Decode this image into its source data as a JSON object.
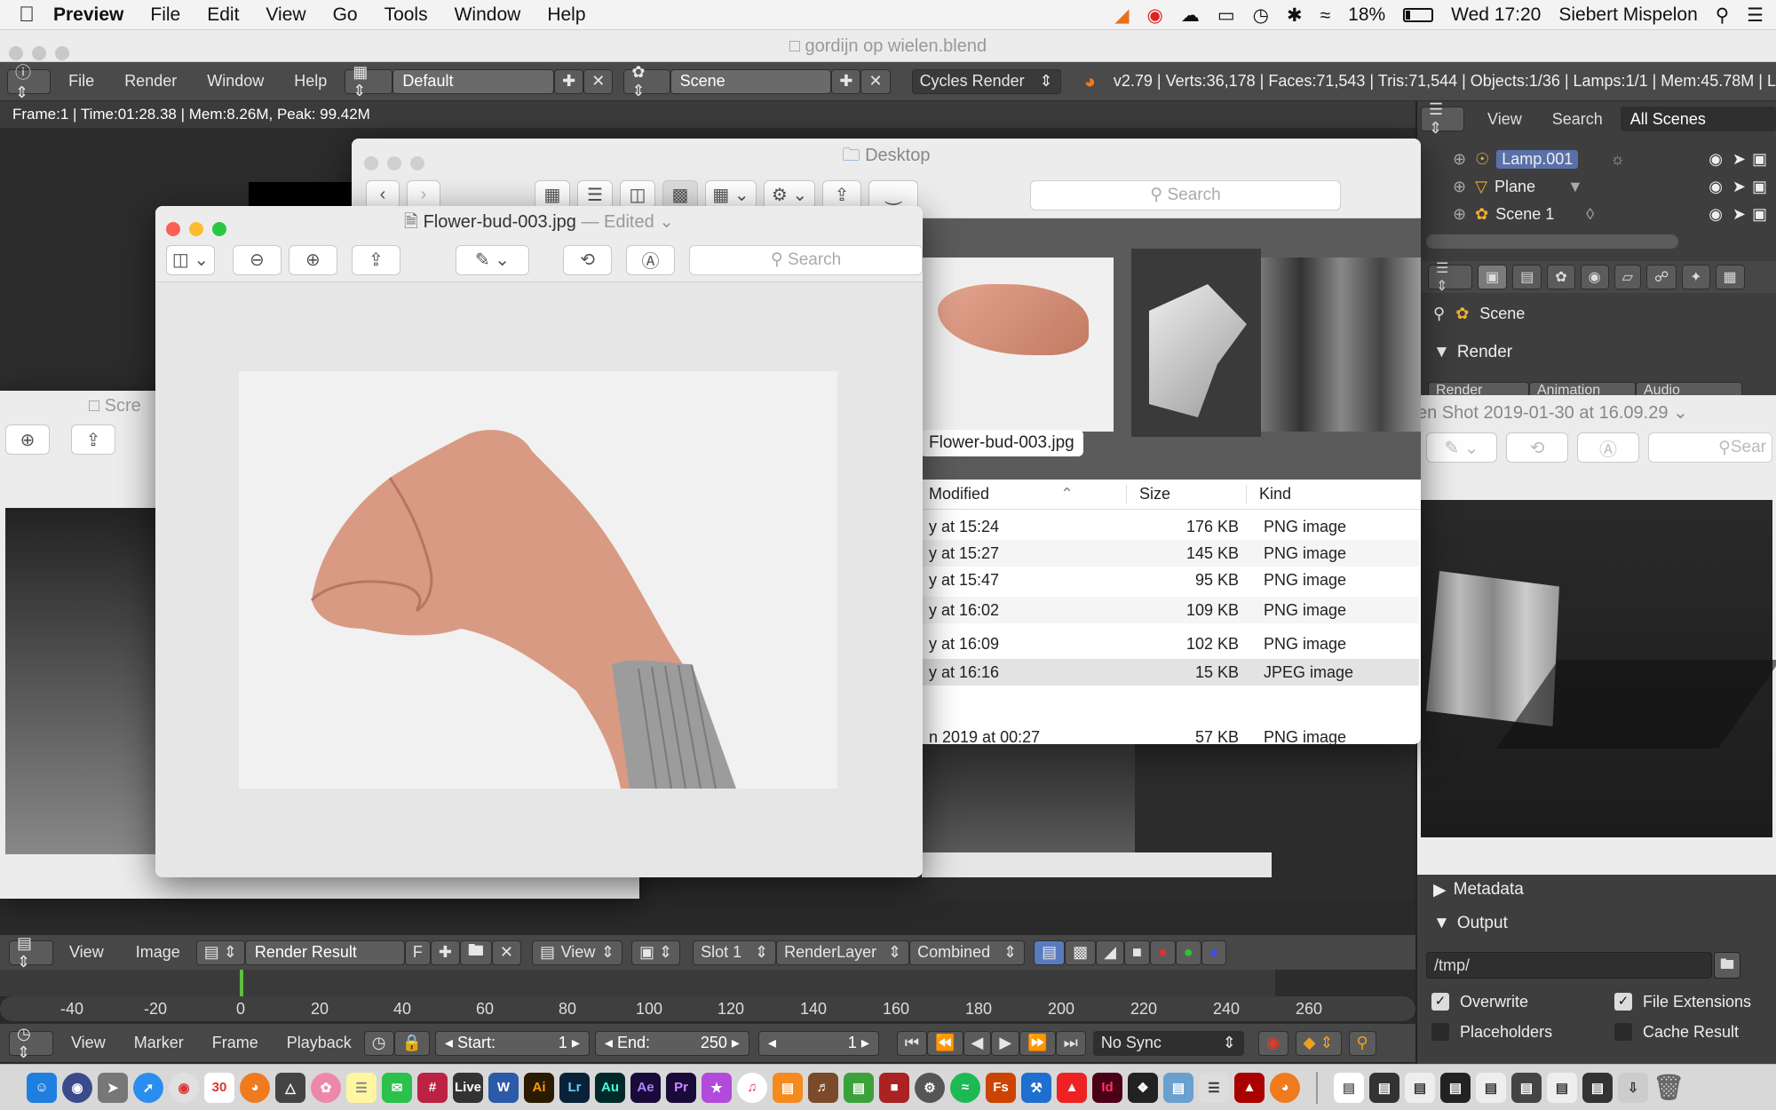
{
  "menubar": {
    "app": "Preview",
    "items": [
      "File",
      "Edit",
      "View",
      "Go",
      "Tools",
      "Window",
      "Help"
    ],
    "battery": "18%",
    "datetime": "Wed 17:20",
    "user": "Siebert Mispelon"
  },
  "blender": {
    "window_title": "gordijn op wielen.blend",
    "header": {
      "menus": [
        "File",
        "Render",
        "Window",
        "Help"
      ],
      "layout": "Default",
      "scene": "Scene",
      "engine": "Cycles Render",
      "stats": "v2.79 | Verts:36,178 | Faces:71,543 | Tris:71,544 | Objects:1/36 | Lamps:1/1 | Mem:45.78M | L"
    },
    "render_info": "Frame:1 | Time:01:28.38 | Mem:8.26M, Peak: 99.42M",
    "outliner": {
      "menus": [
        "View",
        "Search"
      ],
      "filter": "All Scenes",
      "items": [
        "Lamp.001",
        "Plane",
        "Scene 1"
      ]
    },
    "properties": {
      "scene_label": "Scene",
      "render_panel": "Render",
      "render_buttons": [
        "Render",
        "Animation",
        "Audio"
      ],
      "metadata_panel": "Metadata",
      "output_panel": "Output",
      "output_path": "/tmp/",
      "checkboxes": [
        {
          "label": "Overwrite",
          "checked": true
        },
        {
          "label": "File Extensions",
          "checked": true
        },
        {
          "label": "Placeholders",
          "checked": false
        },
        {
          "label": "Cache Result",
          "checked": false
        }
      ]
    },
    "image_editor_header": {
      "menus": [
        "View",
        "Image"
      ],
      "image_name": "Render Result",
      "f_label": "F",
      "view_label": "View",
      "slot": "Slot 1",
      "layer": "RenderLayer",
      "pass": "Combined"
    },
    "timeline": {
      "ticks": [
        "-40",
        "-20",
        "0",
        "20",
        "40",
        "60",
        "80",
        "100",
        "120",
        "140",
        "160",
        "180",
        "200",
        "220",
        "240",
        "260"
      ],
      "menus": [
        "View",
        "Marker",
        "Frame",
        "Playback"
      ],
      "start_label": "Start:",
      "start_value": "1",
      "end_label": "End:",
      "end_value": "250",
      "current_frame": "1",
      "sync": "No Sync"
    }
  },
  "finder": {
    "title": "Desktop",
    "search_placeholder": "Search",
    "thumb_label": "Flower-bud-003.jpg",
    "columns": {
      "modified": "Modified",
      "size": "Size",
      "kind": "Kind"
    },
    "rows": [
      {
        "modified": "y at 15:24",
        "size": "176 KB",
        "kind": "PNG image"
      },
      {
        "modified": "y at 15:27",
        "size": "145 KB",
        "kind": "PNG image"
      },
      {
        "modified": "y at 15:47",
        "size": "95 KB",
        "kind": "PNG image"
      },
      {
        "modified": "y at 16:02",
        "size": "109 KB",
        "kind": "PNG image"
      },
      {
        "modified": "y at 16:09",
        "size": "102 KB",
        "kind": "PNG image"
      },
      {
        "modified": "y at 16:16",
        "size": "15 KB",
        "kind": "JPEG image"
      },
      {
        "modified": "n 2019 at 00:27",
        "size": "57 KB",
        "kind": "PNG image"
      }
    ]
  },
  "preview_main": {
    "filename": "Flower-bud-003.jpg",
    "edited": "— Edited",
    "search_placeholder": "Search"
  },
  "preview_right": {
    "title": "en Shot 2019-01-30 at 16.09.29",
    "search_placeholder": "Sear"
  },
  "preview_left": {
    "title": "Scre"
  },
  "colors": {
    "blender_bg": "#474747",
    "mac_close": "#fc5f57",
    "mac_min": "#fdbc2e",
    "mac_max": "#28c840",
    "selected_row": "#e3e3e3"
  }
}
